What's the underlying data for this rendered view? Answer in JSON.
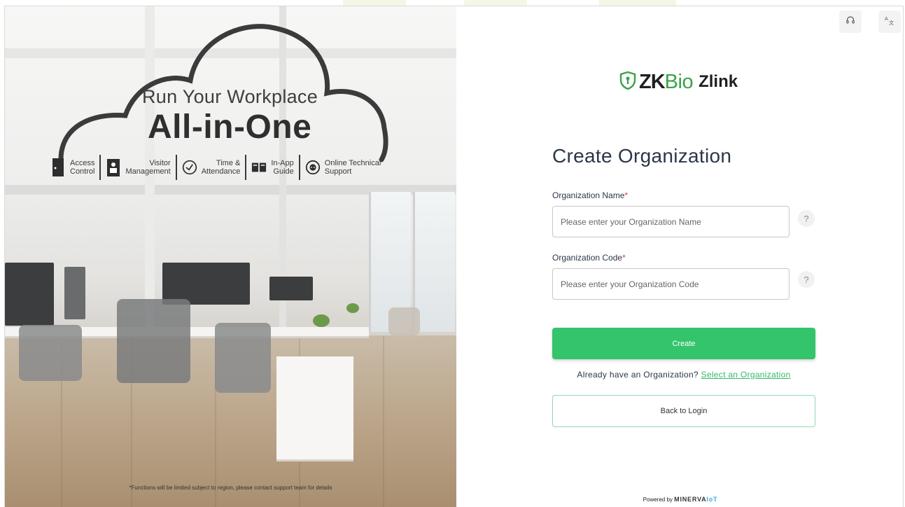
{
  "promo": {
    "headline": "Run Your Workplace",
    "headline_bold": "All-in-One",
    "features": [
      {
        "label": "Access\nControl",
        "icon": "door-icon"
      },
      {
        "label": "Visitor\nManagement",
        "icon": "visitor-badge-icon"
      },
      {
        "label": "Time &\nAttendance",
        "icon": "clock-icon"
      },
      {
        "label": "In-App\nGuide",
        "icon": "book-icon"
      },
      {
        "label": "Online Technical\nSupport",
        "icon": "chat-support-icon"
      }
    ],
    "disclaimer": "*Functions will be limited subject to region, please contact support team for details"
  },
  "topbar": {
    "support_icon": "headset-icon",
    "language_icon": "translate-icon"
  },
  "logo": {
    "zk": "ZK",
    "bio": "Bio",
    "product": "Zlink",
    "brand_color": "#3aa34a"
  },
  "form": {
    "title": "Create Organization",
    "org_name_label": "Organization Name",
    "org_name_placeholder": "Please enter your Organization Name",
    "org_name_value": "",
    "org_code_label": "Organization Code",
    "org_code_placeholder": "Please enter your Organization Code",
    "org_code_value": "",
    "required_mark": "*",
    "help_symbol": "?",
    "create_label": "Create",
    "already_text": "Already have an Organization?",
    "select_link": "Select an Organization",
    "back_label": "Back to Login",
    "accent_color": "#33c46c"
  },
  "footer": {
    "powered_by": "Powered by",
    "brand": "MINERVA",
    "brand_suffix": "IoT"
  }
}
